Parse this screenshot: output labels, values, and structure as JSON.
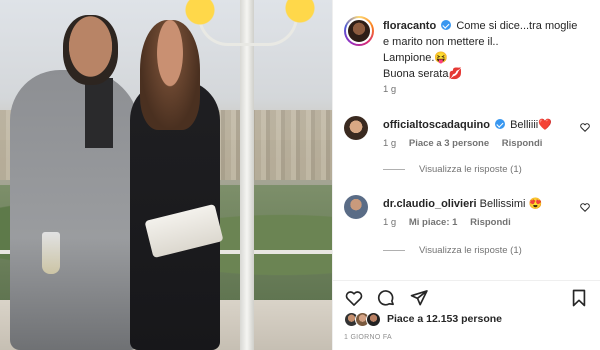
{
  "post": {
    "author": "floracanto",
    "caption_line1": "Come si dice...tra moglie",
    "caption_line2": "e marito non mettere il..",
    "caption_line3": "Lampione.",
    "caption_line3_emoji": "😝",
    "caption_line4": "Buona serata",
    "caption_line4_emoji": "💋",
    "time": "1 g"
  },
  "comments": [
    {
      "user": "officialtoscadaquino",
      "verified": true,
      "text": "Belliiii",
      "emoji": "❤️",
      "time": "1 g",
      "likes": "Piace a 3 persone",
      "reply": "Rispondi",
      "view_replies": "Visualizza le risposte (1)"
    },
    {
      "user": "dr.claudio_olivieri",
      "verified": false,
      "text": "Bellissimi",
      "emoji": "😍",
      "time": "1 g",
      "likes": "Mi piace: 1",
      "reply": "Rispondi",
      "view_replies": "Visualizza le risposte (1)"
    }
  ],
  "footer": {
    "likes_text": "Piace a 12.153 persone",
    "date": "1 GIORNO FA"
  },
  "icons": {
    "like": "heart-icon",
    "comment": "comment-icon",
    "share": "send-icon",
    "save": "bookmark-icon"
  },
  "colors": {
    "verified": "#3897f0",
    "text": "#262626",
    "muted": "#737373"
  }
}
